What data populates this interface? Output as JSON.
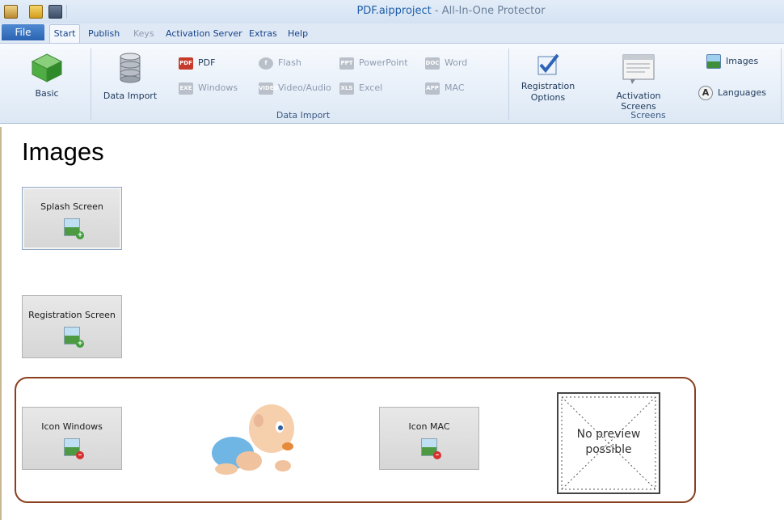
{
  "window": {
    "file_name": "PDF.aipproject",
    "app_name": " - All-In-One Protector",
    "quick_access": [
      "new-icon",
      "open-icon",
      "save-icon"
    ]
  },
  "tabs": {
    "file": "File",
    "items": [
      {
        "label": "Start",
        "active": true
      },
      {
        "label": "Publish"
      },
      {
        "label": "Keys",
        "disabled": true
      },
      {
        "label": "Activation Server"
      },
      {
        "label": "Extras"
      },
      {
        "label": "Help"
      }
    ]
  },
  "ribbon": {
    "basic": {
      "label": "Basic"
    },
    "data_import_btn": {
      "label": "Data Import"
    },
    "data_import_items": {
      "pdf": {
        "label": "PDF",
        "badge": "PDF"
      },
      "windows": {
        "label": "Windows",
        "badge": "EXE"
      },
      "flash": {
        "label": "Flash",
        "badge": "f"
      },
      "video": {
        "label": "Video/Audio",
        "badge": "VIDEO"
      },
      "powerpoint": {
        "label": "PowerPoint",
        "badge": "PPT"
      },
      "excel": {
        "label": "Excel",
        "badge": "XLS"
      },
      "word": {
        "label": "Word",
        "badge": "DOC"
      },
      "mac": {
        "label": "MAC",
        "badge": "APP"
      }
    },
    "data_import_group": "Data Import",
    "registration_options": {
      "line1": "Registration",
      "line2": "Options"
    },
    "activation_screens": {
      "label": "Activation Screens"
    },
    "images": {
      "label": "Images"
    },
    "languages": {
      "label": "Languages",
      "badge": "A"
    },
    "screens_group": "Screens"
  },
  "main": {
    "heading": "Images",
    "buttons": {
      "splash": "Splash Screen",
      "registration": "Registration Screen",
      "icon_windows": "Icon Windows",
      "icon_mac": "Icon MAC"
    },
    "no_preview": {
      "line1": "No preview",
      "line2": "possible"
    }
  }
}
